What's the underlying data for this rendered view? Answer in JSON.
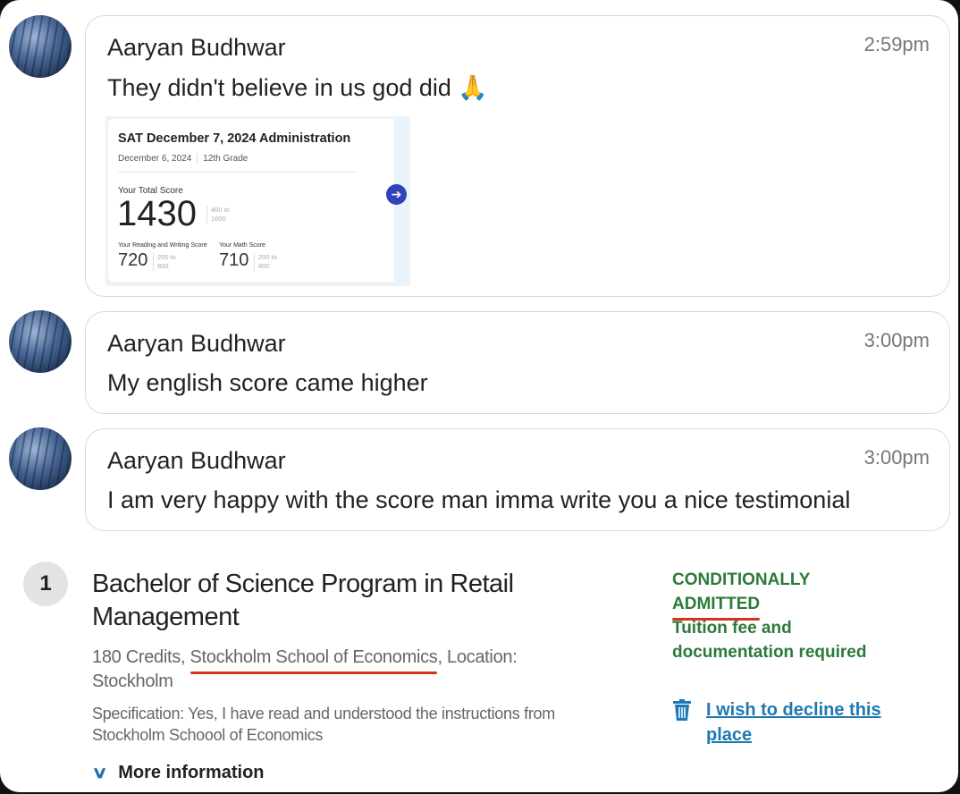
{
  "messages": [
    {
      "author": "Aaryan Budhwar",
      "time": "2:59pm",
      "text": "They didn't believe in us god did 🙏",
      "attachment": {
        "title": "SAT December 7, 2024 Administration",
        "date": "December 6, 2024",
        "grade": "12th Grade",
        "total_label": "Your Total Score",
        "total": "1430",
        "total_range_1": "400 to",
        "total_range_2": "1600",
        "rw_label": "Your Reading and Writing Score",
        "rw": "720",
        "math_label": "Your Math Score",
        "math": "710",
        "sec_range_1": "200 to",
        "sec_range_2": "800"
      }
    },
    {
      "author": "Aaryan Budhwar",
      "time": "3:00pm",
      "text": "My english score came higher"
    },
    {
      "author": "Aaryan Budhwar",
      "time": "3:00pm",
      "text": "I am very happy with the score man imma write you a nice testimonial"
    }
  ],
  "admission": {
    "number": "1",
    "title": "Bachelor of Science Program in Retail Management",
    "credits": "180 Credits, ",
    "school": "Stockholm School of Economics",
    "location": ", Location: Stockholm",
    "specification": "Specification:  Yes, I have read and understood the instructions from Stockholm Schoool of Economics",
    "more": "More information",
    "status_1": "CONDITIONALLY",
    "status_2": "ADMITTED",
    "status_note": "Tuition fee and documentation required",
    "decline": "I wish to decline this place",
    "colors": {
      "status": "#2a7a3a",
      "link": "#1f78b4",
      "underline": "#d8321e"
    }
  }
}
